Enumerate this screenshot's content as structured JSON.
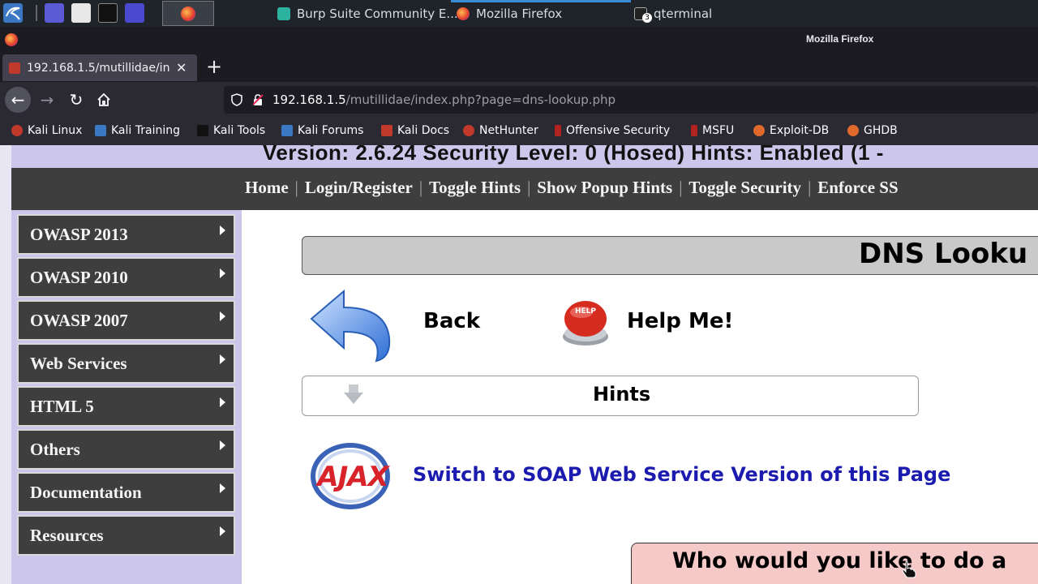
{
  "taskbar": {
    "tasks": [
      {
        "label": "Burp Suite Community E..."
      },
      {
        "label": "Mozilla Firefox"
      },
      {
        "label": "qterminal"
      }
    ],
    "terminal_badge": "3"
  },
  "window": {
    "title": "Mozilla Firefox"
  },
  "browser": {
    "tab_label": "192.168.1.5/mutillidae/in",
    "url_host": "192.168.1.5",
    "url_path": "/mutillidae/index.php?page=dns-lookup.php"
  },
  "bookmarks": [
    {
      "label": "Kali Linux"
    },
    {
      "label": "Kali Training"
    },
    {
      "label": "Kali Tools"
    },
    {
      "label": "Kali Forums"
    },
    {
      "label": "Kali Docs"
    },
    {
      "label": "NetHunter"
    },
    {
      "label": "Offensive Security"
    },
    {
      "label": "MSFU"
    },
    {
      "label": "Exploit-DB"
    },
    {
      "label": "GHDB"
    }
  ],
  "page": {
    "version_line": "Version: 2.6.24     Security Level: 0 (Hosed)     Hints: Enabled (1 -",
    "top_menu": [
      "Home",
      "Login/Register",
      "Toggle Hints",
      "Show Popup Hints",
      "Toggle Security",
      "Enforce SS"
    ],
    "side_menu": [
      "OWASP 2013",
      "OWASP 2010",
      "OWASP 2007",
      "Web Services",
      "HTML 5",
      "Others",
      "Documentation",
      "Resources"
    ],
    "title": "DNS Looku",
    "back_label": "Back",
    "help_label": "Help Me!",
    "help_button_text": "HELP",
    "hints_label": "Hints",
    "ajax_logo_text": "AJAX",
    "soap_link": "Switch to SOAP Web Service Version of this Page",
    "who_text": "Who would you like to do a"
  },
  "colors": {
    "menu_dark": "#3e3e3e",
    "lavender": "#ccc7ea",
    "link_blue": "#1b1bb0",
    "pink_box": "#f6c9c9"
  }
}
